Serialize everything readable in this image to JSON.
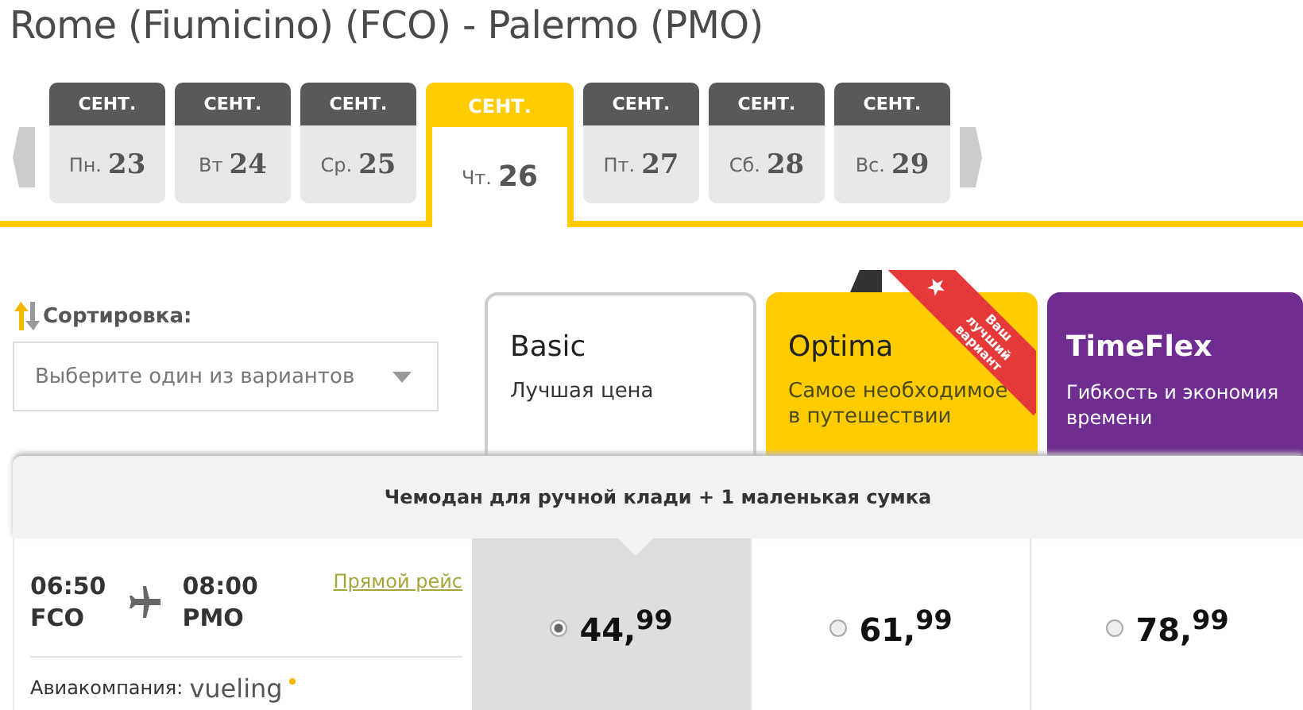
{
  "title": "Rome (Fiumicino) (FCO) - Palermo (PMO)",
  "dates": [
    {
      "month": "СЕНТ.",
      "weekday": "Пн.",
      "day": "23",
      "selected": false
    },
    {
      "month": "СЕНТ.",
      "weekday": "Вт",
      "day": "24",
      "selected": false
    },
    {
      "month": "СЕНТ.",
      "weekday": "Ср.",
      "day": "25",
      "selected": false
    },
    {
      "month": "СЕНТ.",
      "weekday": "Чт.",
      "day": "26",
      "selected": true
    },
    {
      "month": "СЕНТ.",
      "weekday": "Пт.",
      "day": "27",
      "selected": false
    },
    {
      "month": "СЕНТ.",
      "weekday": "Сб.",
      "day": "28",
      "selected": false
    },
    {
      "month": "СЕНТ.",
      "weekday": "Вс.",
      "day": "29",
      "selected": false
    }
  ],
  "sort": {
    "label": "Сортировка:",
    "placeholder": "Выберите один из вариантов"
  },
  "fares": [
    {
      "name": "Basic",
      "subtitle": "Лучшая цена",
      "kind": "plain"
    },
    {
      "name": "Optima",
      "subtitle": "Самое необходимое в путешествии",
      "kind": "yellow",
      "ribbon": "Ваш лучший вариант"
    },
    {
      "name": "TimeFlex",
      "subtitle": "Гибкость и экономия времени",
      "kind": "purple"
    }
  ],
  "baggage": "Чемодан для ручной клади + 1 маленькая сумка",
  "flight": {
    "depart_time": "06:50",
    "depart_code": "FCO",
    "arrive_time": "08:00",
    "arrive_code": "PMO",
    "type": "Прямой рейс",
    "airline_label": "Авиакомпания:",
    "airline": "vueling"
  },
  "prices": [
    {
      "price": "44,$^{99}$",
      "selected": true
    },
    {
      "price": "61,$^{99}$",
      "selected": false
    },
    {
      "price": "78,$^{99}$",
      "selected": false
    }
  ]
}
